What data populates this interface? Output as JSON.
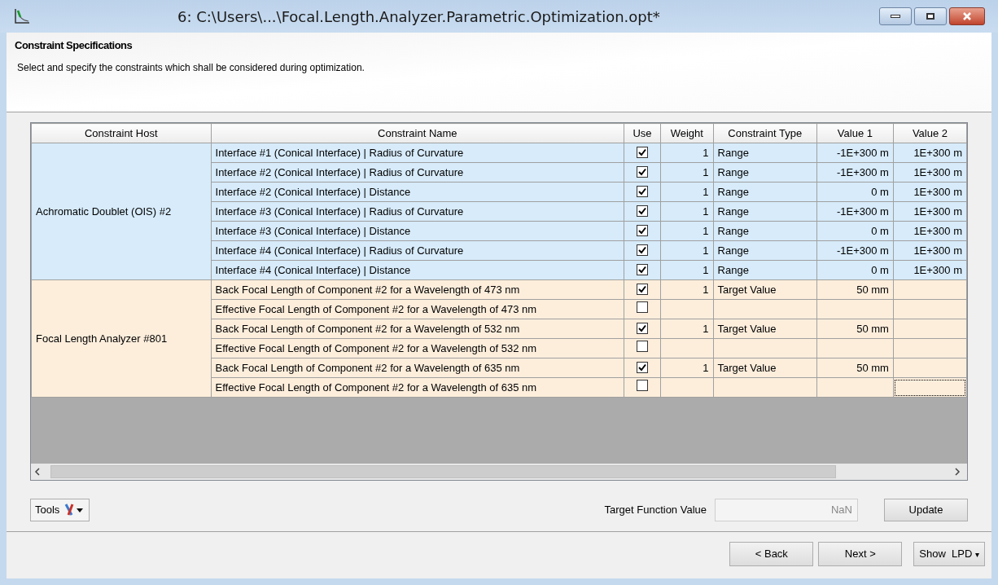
{
  "window": {
    "title": "6: C:\\Users\\...\\Focal.Length.Analyzer.Parametric.Optimization.opt*"
  },
  "header": {
    "title": "Constraint Specifications",
    "description": "Select and specify the constraints which shall be considered during optimization."
  },
  "table": {
    "columns": [
      "Constraint Host",
      "Constraint Name",
      "Use",
      "Weight",
      "Constraint Type",
      "Value 1",
      "Value 2"
    ],
    "groups": [
      {
        "host": "Achromatic Doublet (OIS) #2",
        "color": "#d7ebfa",
        "rows": [
          {
            "name": "Interface #1 (Conical Interface) | Radius of Curvature",
            "use": true,
            "weight": "1",
            "type": "Range",
            "value_1": "-1E+300 m",
            "value_2": "1E+300 m",
            "focused": false
          },
          {
            "name": "Interface #2 (Conical Interface) | Radius of Curvature",
            "use": true,
            "weight": "1",
            "type": "Range",
            "value_1": "-1E+300 m",
            "value_2": "1E+300 m",
            "focused": false
          },
          {
            "name": "Interface #2 (Conical Interface) | Distance",
            "use": true,
            "weight": "1",
            "type": "Range",
            "value_1": "0 m",
            "value_2": "1E+300 m",
            "focused": false
          },
          {
            "name": "Interface #3 (Conical Interface) | Radius of Curvature",
            "use": true,
            "weight": "1",
            "type": "Range",
            "value_1": "-1E+300 m",
            "value_2": "1E+300 m",
            "focused": false
          },
          {
            "name": "Interface #3 (Conical Interface) | Distance",
            "use": true,
            "weight": "1",
            "type": "Range",
            "value_1": "0 m",
            "value_2": "1E+300 m",
            "focused": false
          },
          {
            "name": "Interface #4 (Conical Interface) | Radius of Curvature",
            "use": true,
            "weight": "1",
            "type": "Range",
            "value_1": "-1E+300 m",
            "value_2": "1E+300 m",
            "focused": false
          },
          {
            "name": "Interface #4 (Conical Interface) | Distance",
            "use": true,
            "weight": "1",
            "type": "Range",
            "value_1": "0 m",
            "value_2": "1E+300 m",
            "focused": false
          }
        ]
      },
      {
        "host": "Focal Length Analyzer #801",
        "color": "#fdeedc",
        "rows": [
          {
            "name": "Back Focal Length of Component #2 for a Wavelength of 473 nm",
            "use": true,
            "weight": "1",
            "type": "Target Value",
            "value_1": "50 mm",
            "focused": false
          },
          {
            "name": "Effective Focal Length of Component #2 for a Wavelength of 473 nm",
            "use": false,
            "focused": false
          },
          {
            "name": "Back Focal Length of Component #2 for a Wavelength of 532 nm",
            "use": true,
            "weight": "1",
            "type": "Target Value",
            "value_1": "50 mm",
            "focused": false
          },
          {
            "name": "Effective Focal Length of Component #2 for a Wavelength of 532 nm",
            "use": false,
            "focused": false
          },
          {
            "name": "Back Focal Length of Component #2 for a Wavelength of 635 nm",
            "use": true,
            "weight": "1",
            "type": "Target Value",
            "value_1": "50 mm",
            "focused": false
          },
          {
            "name": "Effective Focal Length of Component #2 for a Wavelength of 635 nm",
            "use": false,
            "focused": true
          }
        ]
      }
    ]
  },
  "tools_button": "Tools",
  "target_function": {
    "label": "Target Function Value",
    "value": "NaN"
  },
  "update_button": "Update",
  "nav_buttons": [
    "< Back",
    "Next >"
  ],
  "show_button": {
    "label": "Show  LPD",
    "arrow": "▾"
  }
}
